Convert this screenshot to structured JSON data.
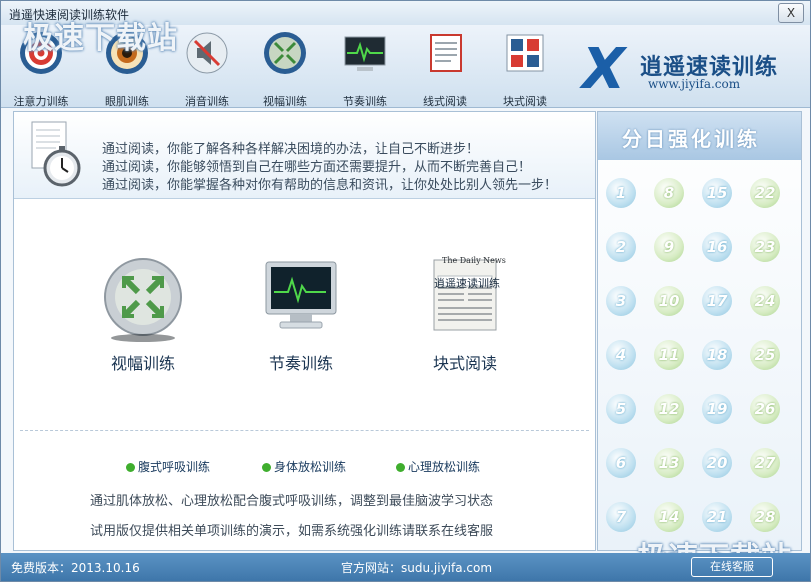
{
  "window": {
    "title": "逍遥快速阅读训练软件",
    "close": "X"
  },
  "watermark": "极速下载站",
  "toolbar": {
    "items": [
      {
        "label": "注意力训练"
      },
      {
        "label": "眼肌训练"
      },
      {
        "label": "消音训练"
      },
      {
        "label": "视幅训练"
      },
      {
        "label": "节奏训练"
      },
      {
        "label": "线式阅读"
      },
      {
        "label": "块式阅读"
      }
    ]
  },
  "brand": {
    "logo": "X",
    "name": "逍遥速读训练",
    "url": "www.jiyifa.com"
  },
  "banner": {
    "lines": [
      "通过阅读，你能了解各种各样解决困境的办法，让自己不断进步！",
      "通过阅读，你能够领悟到自己在哪些方面还需要提升，从而不断完善自己！",
      "通过阅读，你能掌握各种对你有帮助的信息和资讯，让你处处比别人领先一步！"
    ]
  },
  "main": {
    "big_buttons": [
      {
        "label": "视幅训练"
      },
      {
        "label": "节奏训练"
      },
      {
        "label": "块式阅读",
        "card_text": "逍遥速读训练",
        "paper_title": "The Daily News"
      }
    ],
    "options": [
      "腹式呼吸训练",
      "身体放松训练",
      "心理放松训练"
    ],
    "notes": [
      "通过肌体放松、心理放松配合腹式呼吸训练，调整到最佳脑波学习状态",
      "试用版仅提供相关单项训练的演示，如需系统强化训练请联系在线客服"
    ]
  },
  "side": {
    "title": "分日强化训练",
    "days": [
      [
        1,
        8,
        15,
        22
      ],
      [
        2,
        9,
        16,
        23
      ],
      [
        3,
        10,
        17,
        24
      ],
      [
        4,
        11,
        18,
        25
      ],
      [
        5,
        12,
        19,
        26
      ],
      [
        6,
        13,
        20,
        27
      ],
      [
        7,
        14,
        21,
        28
      ]
    ]
  },
  "status": {
    "version": "免费版本：2013.10.16",
    "site": "官方网站：sudu.jiyifa.com",
    "online": "在线客服"
  },
  "colors": {
    "accent": "#3e76aa",
    "green_dot": "#3fae2e",
    "brand": "#1b5fa8"
  }
}
